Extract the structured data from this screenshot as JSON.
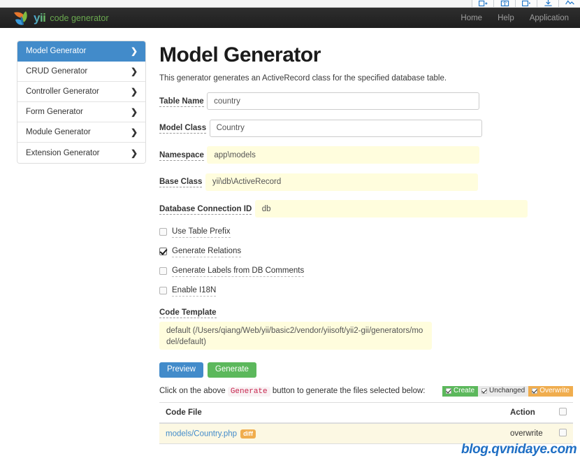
{
  "browser_toolbar": {
    "icons": [
      "new-tab-icon",
      "book-icon",
      "window-icon",
      "download-icon",
      "activity-icon"
    ]
  },
  "navbar": {
    "brand_wordmark": "yii",
    "brand_tagline": "code generator",
    "logo_icon": "yii-leaf-logo",
    "links": [
      {
        "label": "Home"
      },
      {
        "label": "Help"
      },
      {
        "label": "Application"
      }
    ]
  },
  "sidebar": {
    "items": [
      {
        "label": "Model Generator",
        "active": true
      },
      {
        "label": "CRUD Generator",
        "active": false
      },
      {
        "label": "Controller Generator",
        "active": false
      },
      {
        "label": "Form Generator",
        "active": false
      },
      {
        "label": "Module Generator",
        "active": false
      },
      {
        "label": "Extension Generator",
        "active": false
      }
    ],
    "chevron_icon": "chevron-right-icon"
  },
  "main": {
    "title": "Model Generator",
    "lead": "This generator generates an ActiveRecord class for the specified database table.",
    "fields": [
      {
        "label": "Table Name",
        "value": "country",
        "style": "plain"
      },
      {
        "label": "Model Class",
        "value": "Country",
        "style": "plain"
      },
      {
        "label": "Namespace",
        "value": "app\\models",
        "style": "autofill"
      },
      {
        "label": "Base Class",
        "value": "yii\\db\\ActiveRecord",
        "style": "autofill"
      },
      {
        "label": "Database Connection ID",
        "value": "db",
        "style": "autofill"
      }
    ],
    "checkboxes": [
      {
        "label": "Use Table Prefix",
        "checked": false
      },
      {
        "label": "Generate Relations",
        "checked": true
      },
      {
        "label": "Generate Labels from DB Comments",
        "checked": false
      },
      {
        "label": "Enable I18N",
        "checked": false
      }
    ],
    "code_template": {
      "label": "Code Template",
      "value": "default (/Users/qiang/Web/yii/basic2/vendor/yiisoft/yii2-gii/generators/model/default)"
    },
    "buttons": {
      "preview": "Preview",
      "generate": "Generate"
    },
    "hint": {
      "before": "Click on the above",
      "code": "Generate",
      "after": "button to generate the files selected below:"
    },
    "legend": [
      {
        "label": "Create",
        "kind": "create"
      },
      {
        "label": "Unchanged",
        "kind": "unchanged"
      },
      {
        "label": "Overwrite",
        "kind": "overwrite"
      }
    ],
    "files_table": {
      "headers": [
        "Code File",
        "Action",
        ""
      ],
      "rows": [
        {
          "file": "models/Country.php",
          "badge": "diff",
          "action": "overwrite",
          "checked": false
        }
      ]
    }
  },
  "watermark": "blog.qvnidaye.com",
  "colors": {
    "navbar_bg": "#272727",
    "accent_blue": "#428bca",
    "success_green": "#5cb85c",
    "warning_orange": "#f0ad4e",
    "autofill_yellow": "#fffddd",
    "row_yellow": "#fcf8e3",
    "watermark_blue": "#1f6fc4"
  }
}
